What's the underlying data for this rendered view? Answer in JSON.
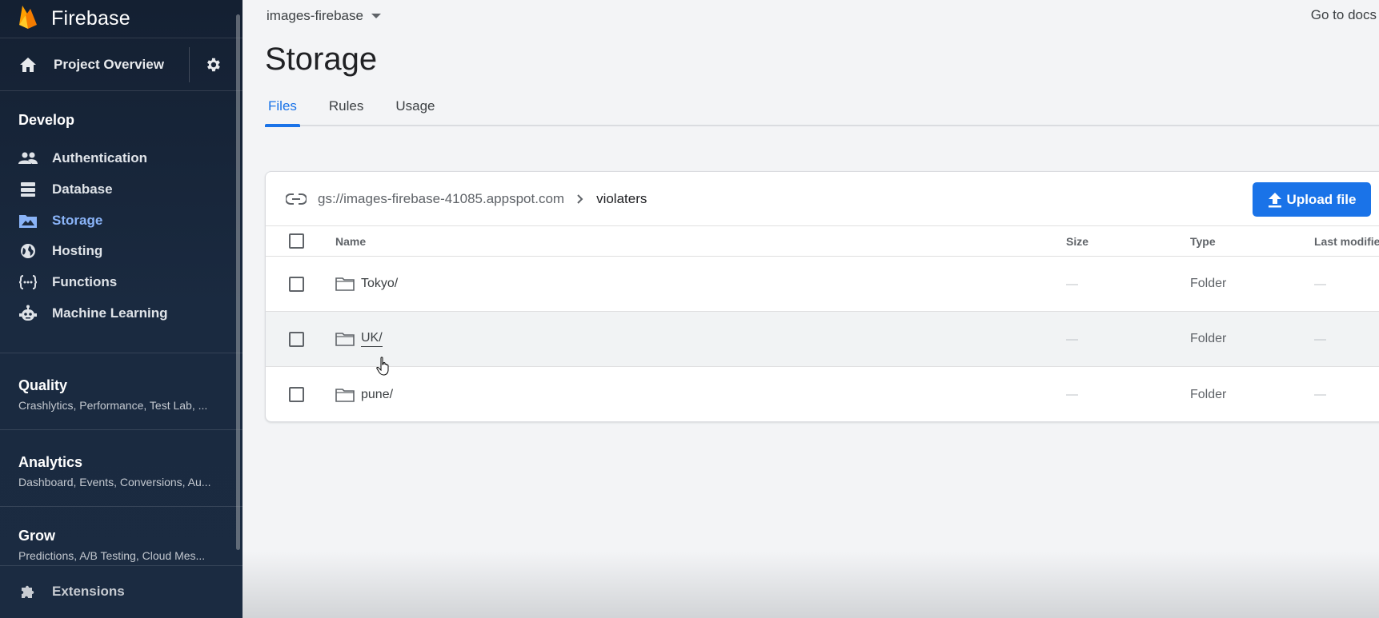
{
  "sidebar": {
    "brand": "Firebase",
    "overview_label": "Project Overview",
    "develop": {
      "title": "Develop",
      "items": [
        {
          "label": "Authentication",
          "icon": "people-icon"
        },
        {
          "label": "Database",
          "icon": "database-icon"
        },
        {
          "label": "Storage",
          "icon": "storage-icon",
          "active": true
        },
        {
          "label": "Hosting",
          "icon": "globe-icon"
        },
        {
          "label": "Functions",
          "icon": "functions-icon"
        },
        {
          "label": "Machine Learning",
          "icon": "robot-icon"
        }
      ]
    },
    "quality": {
      "title": "Quality",
      "sub": "Crashlytics, Performance, Test Lab, ..."
    },
    "analytics": {
      "title": "Analytics",
      "sub": "Dashboard, Events, Conversions, Au..."
    },
    "grow": {
      "title": "Grow",
      "sub": "Predictions, A/B Testing, Cloud Mes..."
    },
    "extensions_label": "Extensions"
  },
  "header": {
    "project": "images-firebase",
    "docs_link": "Go to docs",
    "title": "Storage"
  },
  "tabs": [
    {
      "label": "Files",
      "active": true
    },
    {
      "label": "Rules"
    },
    {
      "label": "Usage"
    }
  ],
  "browser": {
    "bucket": "gs://images-firebase-41085.appspot.com",
    "folder": "violaters",
    "upload_label": "Upload file",
    "columns": {
      "name": "Name",
      "size": "Size",
      "type": "Type",
      "modified": "Last modified"
    },
    "rows": [
      {
        "name": "Tokyo/",
        "size": "—",
        "type": "Folder",
        "modified": "—"
      },
      {
        "name": "UK/",
        "size": "—",
        "type": "Folder",
        "modified": "—"
      },
      {
        "name": "pune/",
        "size": "—",
        "type": "Folder",
        "modified": "—"
      }
    ]
  },
  "colors": {
    "sidebar_bg": "#1b2a3f",
    "accent": "#1a73e8",
    "active_nav": "#8ab4f8",
    "firebase_yellow": "#ffca28",
    "firebase_orange": "#f57c00"
  }
}
